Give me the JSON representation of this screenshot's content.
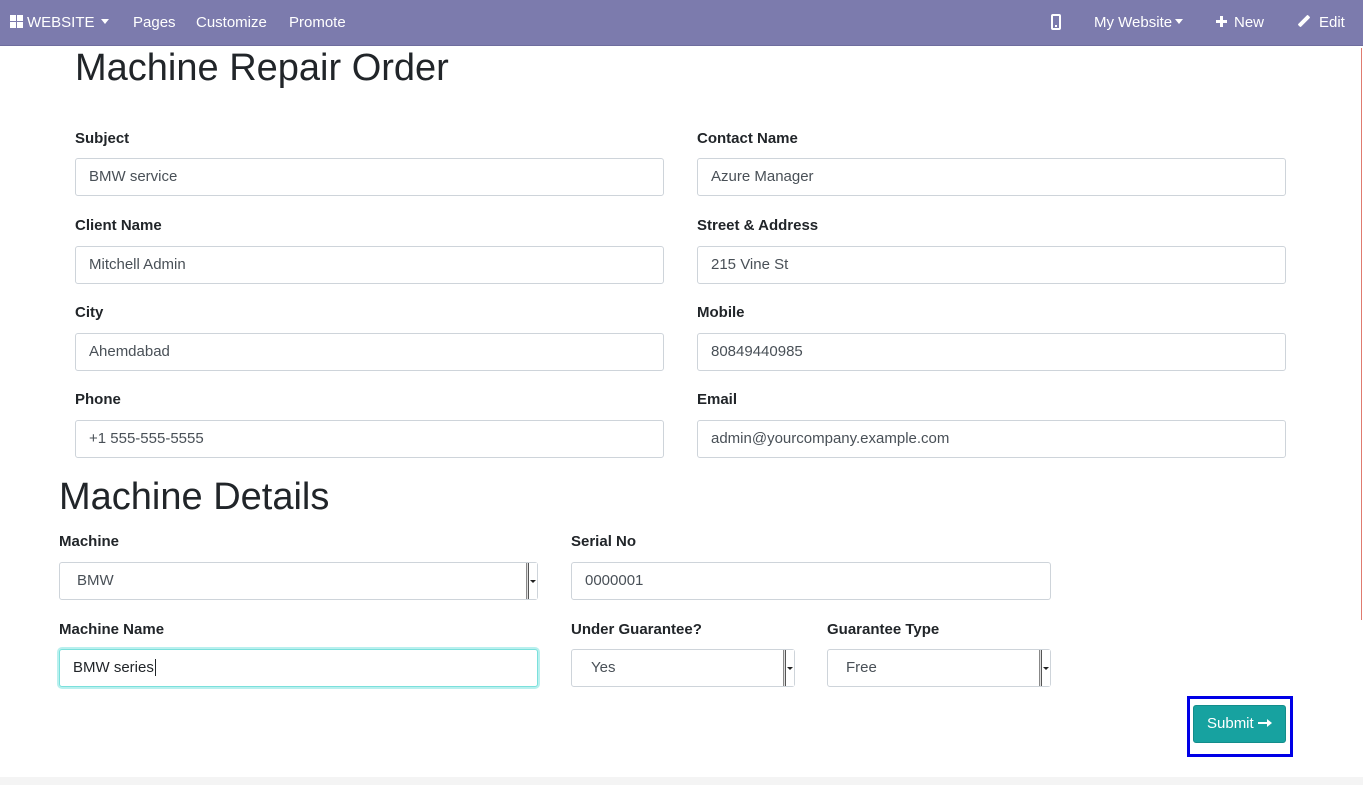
{
  "topbar": {
    "website_label": "WEBSITE",
    "pages_label": "Pages",
    "customize_label": "Customize",
    "promote_label": "Promote",
    "my_website_label": "My Website",
    "new_label": "New",
    "edit_label": "Edit",
    "background_color": "#7c7bad"
  },
  "repair_order": {
    "title": "Machine Repair Order",
    "fields": {
      "subject": {
        "label": "Subject",
        "value": "BMW service"
      },
      "contact_name": {
        "label": "Contact Name",
        "value": "Azure Manager"
      },
      "client_name": {
        "label": "Client Name",
        "value": "Mitchell Admin"
      },
      "street_address": {
        "label": "Street & Address",
        "value": "215 Vine St"
      },
      "city": {
        "label": "City",
        "value": "Ahemdabad"
      },
      "mobile": {
        "label": "Mobile",
        "value": "80849440985"
      },
      "phone": {
        "label": "Phone",
        "value": "+1 555-555-5555"
      },
      "email": {
        "label": "Email",
        "value": "admin@yourcompany.example.com"
      }
    }
  },
  "machine_details": {
    "title": "Machine Details",
    "fields": {
      "machine": {
        "label": "Machine",
        "value": "BMW"
      },
      "serial_no": {
        "label": "Serial No",
        "value": "0000001"
      },
      "machine_name": {
        "label": "Machine Name",
        "value": "BMW series"
      },
      "under_guarantee": {
        "label": "Under Guarantee?",
        "value": "Yes"
      },
      "guarantee_type": {
        "label": "Guarantee Type",
        "value": "Free"
      }
    }
  },
  "submit": {
    "label": "Submit",
    "color": "#17a2a0",
    "highlight_color": "#0000e6"
  }
}
